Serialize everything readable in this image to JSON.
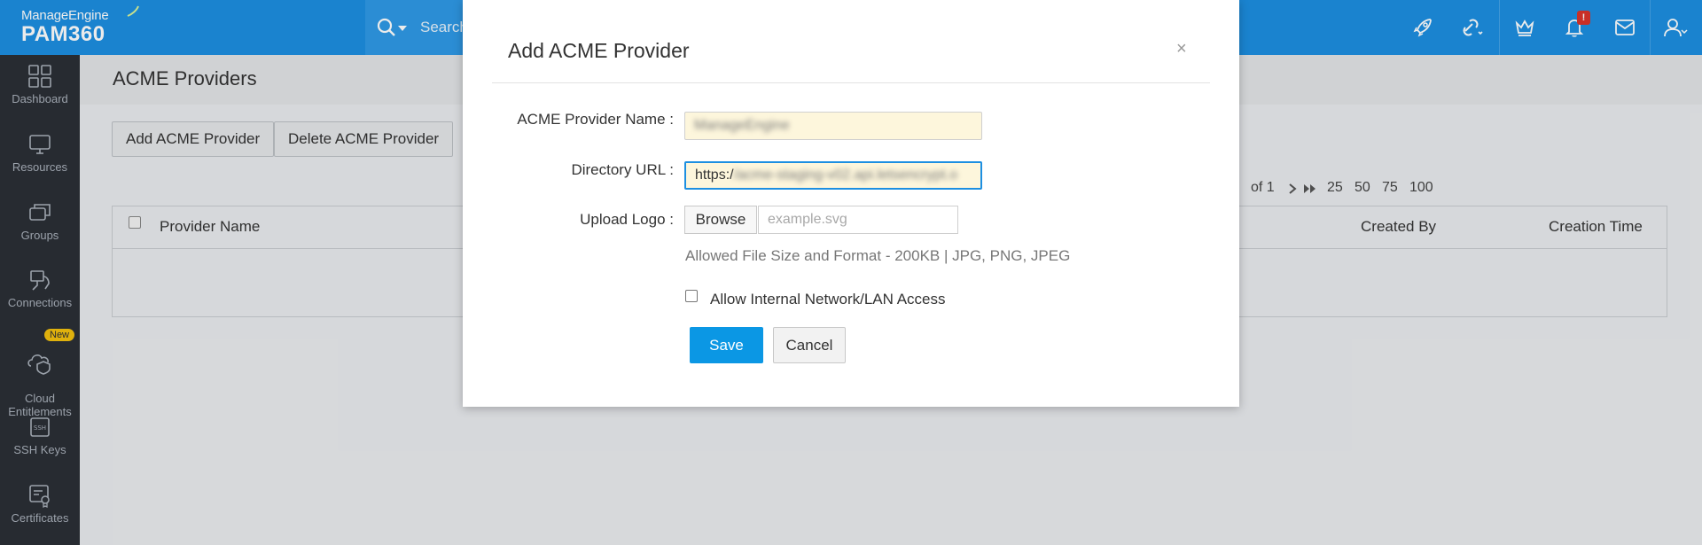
{
  "header": {
    "brand": "ManageEngine",
    "product": "PAM360",
    "search_placeholder": "Search",
    "notification_count": "!",
    "icons": [
      "rocket-icon",
      "link-icon",
      "crown-icon",
      "bell-icon",
      "mail-icon",
      "user-icon"
    ]
  },
  "sidebar": {
    "items": [
      {
        "label": "Dashboard",
        "icon": "dashboard-icon"
      },
      {
        "label": "Resources",
        "icon": "monitor-icon"
      },
      {
        "label": "Groups",
        "icon": "groups-icon"
      },
      {
        "label": "Connections",
        "icon": "connections-icon"
      },
      {
        "label": "Cloud\nEntitlements",
        "icon": "cloud-shield-icon"
      },
      {
        "label": "SSH Keys",
        "icon": "ssh-icon"
      },
      {
        "label": "Certificates",
        "icon": "certificate-icon"
      }
    ],
    "new_badge": "New"
  },
  "page": {
    "title": "ACME Providers",
    "add_button": "Add ACME Provider",
    "delete_button": "Delete ACME Provider",
    "pager": {
      "of_text": "of 1",
      "sizes": [
        "25",
        "50",
        "75",
        "100"
      ]
    },
    "columns": {
      "provider_name": "Provider Name",
      "created_by": "Created By",
      "creation_time": "Creation Time"
    }
  },
  "modal": {
    "title": "Add ACME Provider",
    "close": "×",
    "name_label": "ACME Provider Name :",
    "name_value": "ManageEngine",
    "url_label": "Directory URL :",
    "url_prefix": "https:/",
    "url_rest": "/acme-staging-v02.api.letsencrypt.o",
    "logo_label": "Upload Logo :",
    "browse": "Browse",
    "file_placeholder": "example.svg",
    "hint": "Allowed File Size and Format - 200KB | JPG, PNG, JPEG",
    "lan_checkbox_label": "Allow Internal Network/LAN Access",
    "lan_checked": false,
    "save": "Save",
    "cancel": "Cancel"
  },
  "colors": {
    "header": "#1d8fe1",
    "sidebar": "#2b2f36",
    "primary_button": "#0b97e4",
    "badge": "#f2c10f",
    "alert": "#d9342b"
  }
}
